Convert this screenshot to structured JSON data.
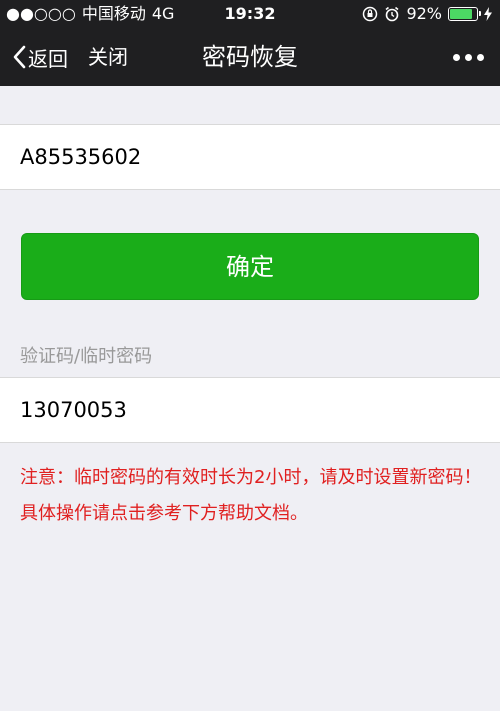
{
  "status_bar": {
    "signal": "●●○○○",
    "carrier": "中国移动",
    "network": "4G",
    "time": "19:32",
    "battery": "92%",
    "battery_level": 0.92
  },
  "nav": {
    "back_label": "返回",
    "close_label": "关闭",
    "title": "密码恢复"
  },
  "account_field": {
    "value": "A85535602"
  },
  "confirm_button": {
    "label": "确定"
  },
  "code_field": {
    "label": "验证码/临时密码",
    "value": "13070053"
  },
  "notice": "注意：临时密码的有效时长为2小时，请及时设置新密码！具体操作请点击参考下方帮助文档。",
  "colors": {
    "primary_green": "#1aad19",
    "warning_red": "#e02020",
    "nav_bg": "#1f1f21"
  }
}
